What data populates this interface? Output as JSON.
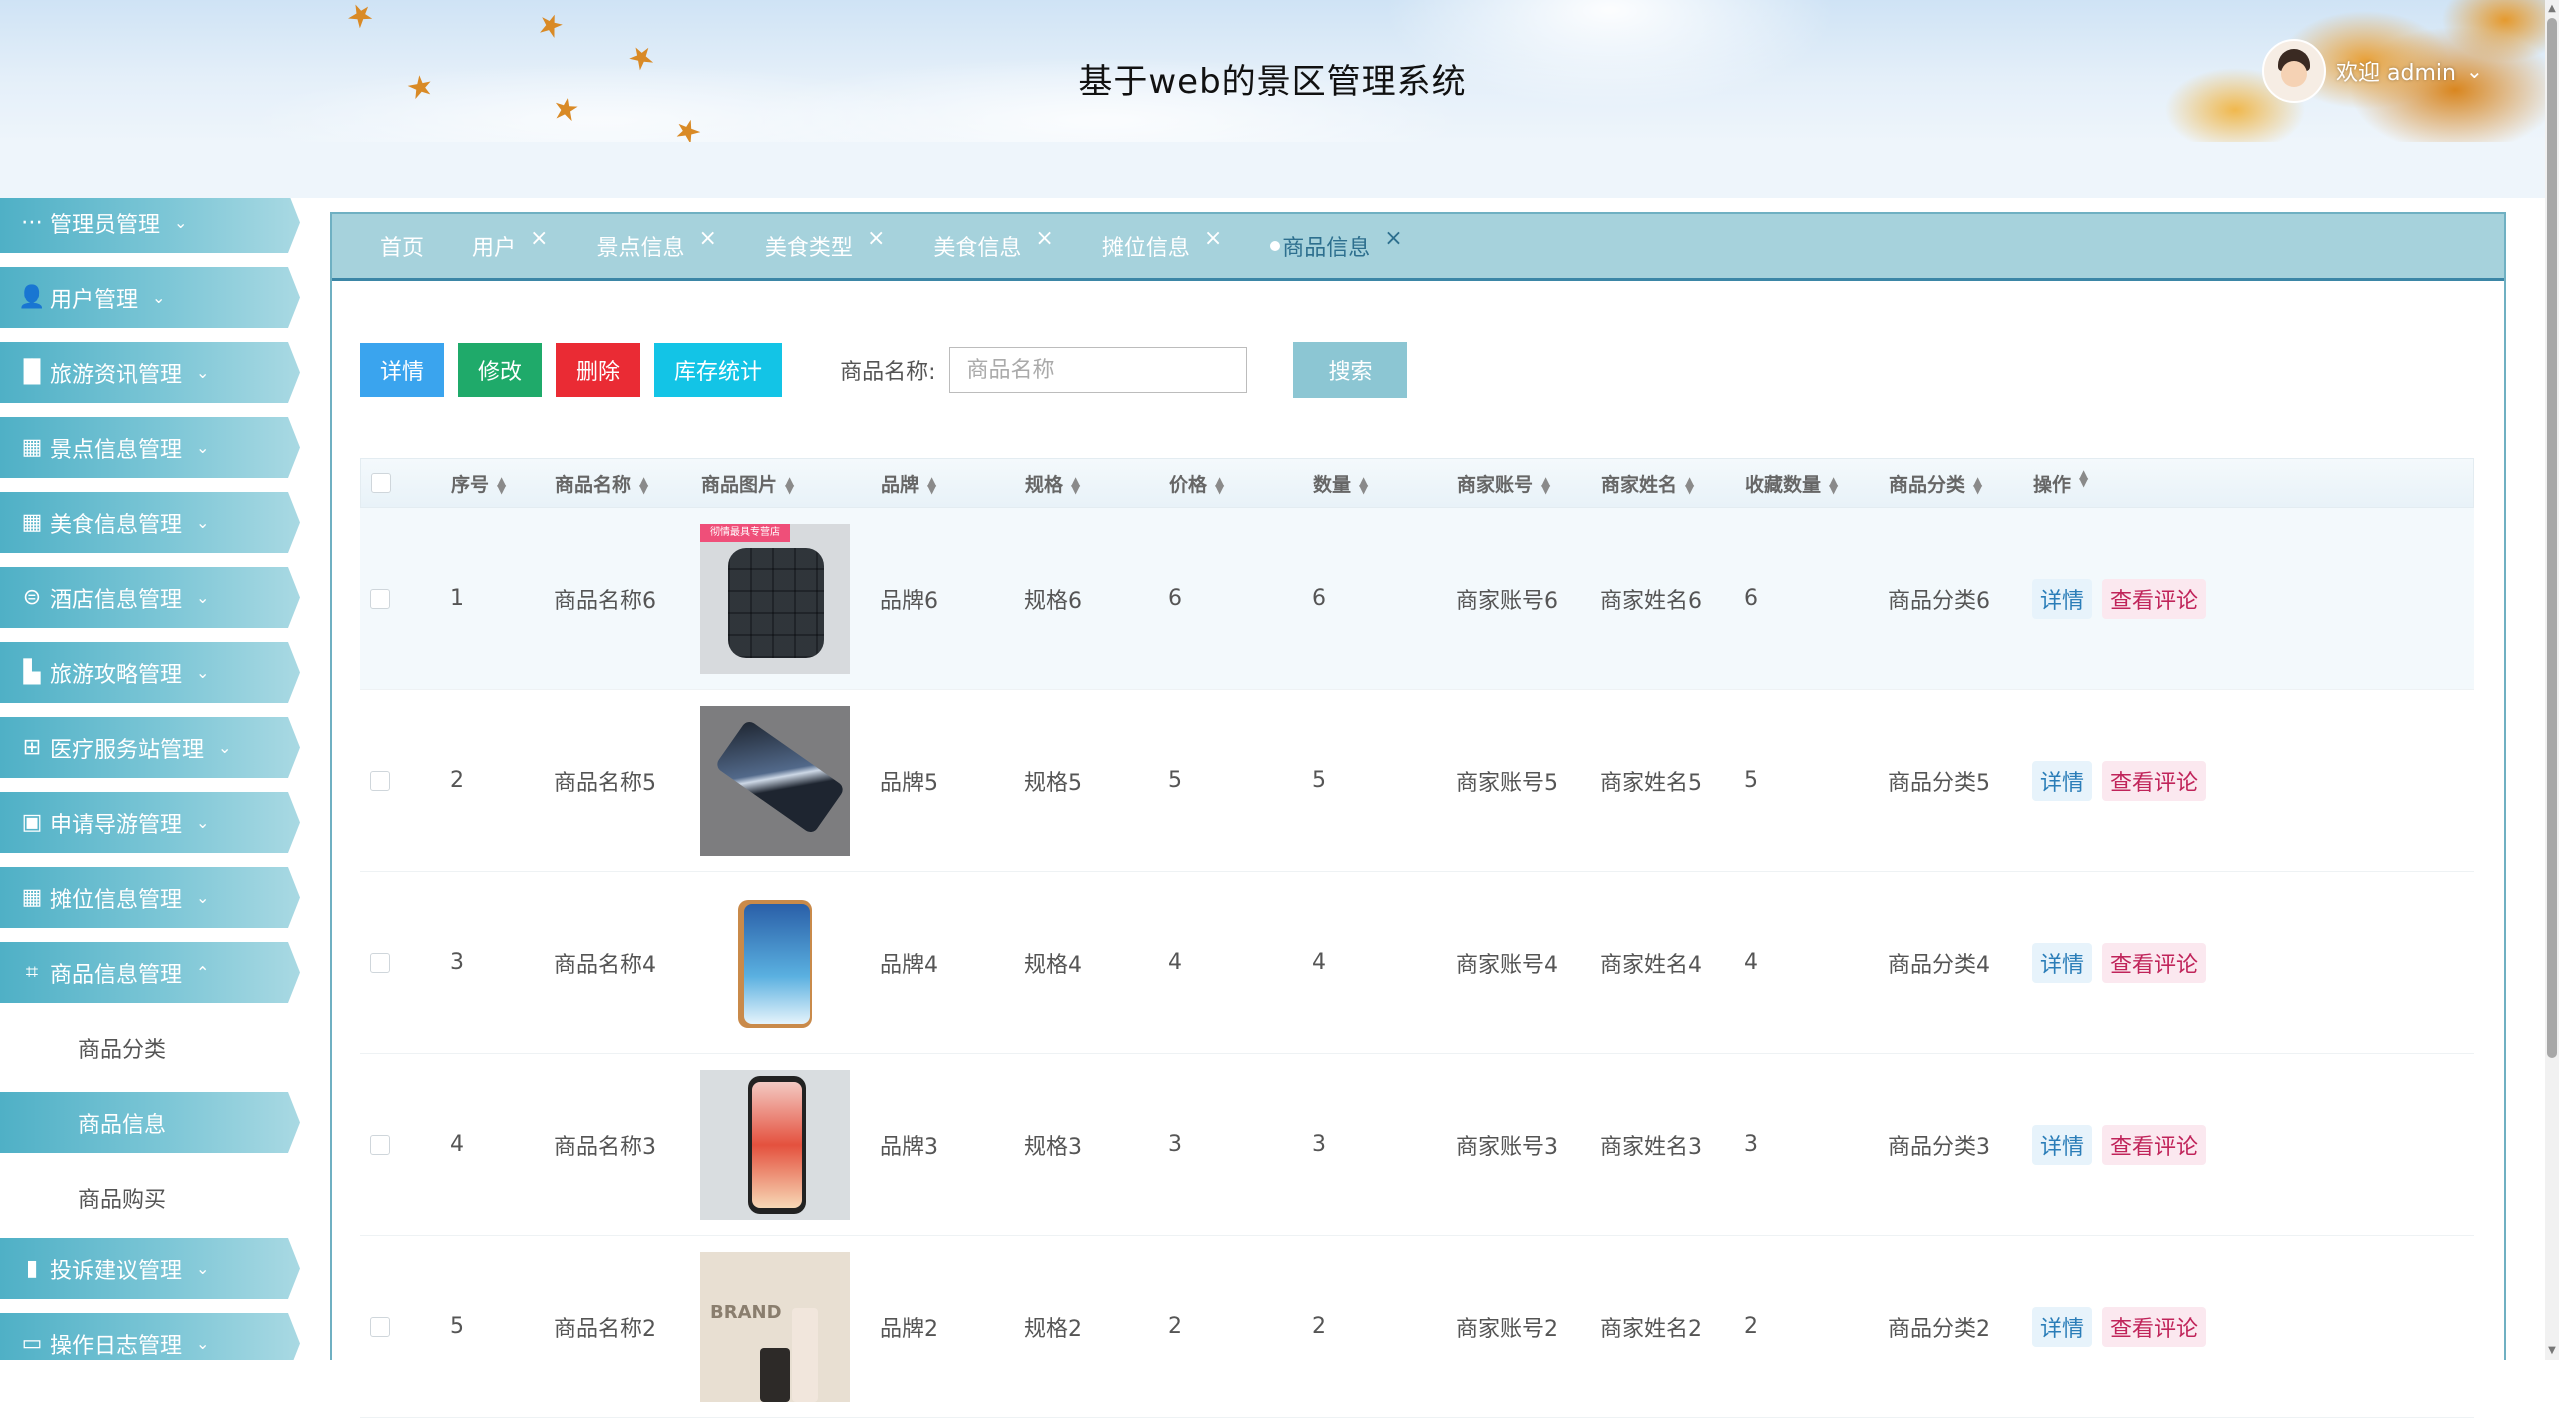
{
  "header": {
    "title": "基于web的景区管理系统",
    "welcome": "欢迎 admin",
    "caret": "⌄"
  },
  "sidebar": {
    "items": [
      {
        "label": "管理员管理",
        "icon": "more-icon",
        "glyph": "⋯",
        "chev": "⌄"
      },
      {
        "label": "用户管理",
        "icon": "user-icon",
        "glyph": "👤",
        "chev": "⌄"
      },
      {
        "label": "旅游资讯管理",
        "icon": "book-icon",
        "glyph": "▐▌",
        "chev": "⌄"
      },
      {
        "label": "景点信息管理",
        "icon": "store-icon",
        "glyph": "▦",
        "chev": "⌄"
      },
      {
        "label": "美食信息管理",
        "icon": "grid-icon",
        "glyph": "▦",
        "chev": "⌄"
      },
      {
        "label": "酒店信息管理",
        "icon": "car-icon",
        "glyph": "⊜",
        "chev": "⌄"
      },
      {
        "label": "旅游攻略管理",
        "icon": "building-icon",
        "glyph": "▙",
        "chev": "⌄"
      },
      {
        "label": "医疗服务站管理",
        "icon": "gift-icon",
        "glyph": "⊞",
        "chev": "⌄"
      },
      {
        "label": "申请导游管理",
        "icon": "briefcase-icon",
        "glyph": "▣",
        "chev": "⌄"
      },
      {
        "label": "摊位信息管理",
        "icon": "apps-icon",
        "glyph": "▦",
        "chev": "⌄"
      },
      {
        "label": "商品信息管理",
        "icon": "crop-icon",
        "glyph": "⌗",
        "chev": "⌃"
      },
      {
        "label": "投诉建议管理",
        "icon": "bookmark-icon",
        "glyph": "▮",
        "chev": "⌄"
      },
      {
        "label": "操作日志管理",
        "icon": "image-icon",
        "glyph": "▭",
        "chev": "⌄"
      }
    ],
    "sub_items": [
      "商品分类",
      "商品信息",
      "商品购买"
    ]
  },
  "tabs": [
    {
      "label": "首页",
      "close": ""
    },
    {
      "label": "用户",
      "close": "×"
    },
    {
      "label": "景点信息",
      "close": "×"
    },
    {
      "label": "美食类型",
      "close": "×"
    },
    {
      "label": "美食信息",
      "close": "×"
    },
    {
      "label": "摊位信息",
      "close": "×"
    },
    {
      "label": "商品信息",
      "close": "×",
      "active": true
    }
  ],
  "toolbar": {
    "detail": "详情",
    "edit": "修改",
    "delete": "删除",
    "stock": "库存统计",
    "search_label": "商品名称:",
    "search_placeholder": "商品名称",
    "search_button": "搜索"
  },
  "table": {
    "columns": [
      "序号",
      "商品名称",
      "商品图片",
      "品牌",
      "规格",
      "价格",
      "数量",
      "商家账号",
      "商家姓名",
      "收藏数量",
      "商品分类",
      "操作"
    ],
    "thumb_tag": "彻情最具专营店",
    "thumb_brand": "BRAND",
    "rows": [
      {
        "idx": "1",
        "name": "商品名称6",
        "brand": "品牌6",
        "spec": "规格6",
        "price": "6",
        "qty": "6",
        "merchant_account": "商家账号6",
        "merchant_name": "商家姓名6",
        "favorites": "6",
        "category": "商品分类6"
      },
      {
        "idx": "2",
        "name": "商品名称5",
        "brand": "品牌5",
        "spec": "规格5",
        "price": "5",
        "qty": "5",
        "merchant_account": "商家账号5",
        "merchant_name": "商家姓名5",
        "favorites": "5",
        "category": "商品分类5"
      },
      {
        "idx": "3",
        "name": "商品名称4",
        "brand": "品牌4",
        "spec": "规格4",
        "price": "4",
        "qty": "4",
        "merchant_account": "商家账号4",
        "merchant_name": "商家姓名4",
        "favorites": "4",
        "category": "商品分类4"
      },
      {
        "idx": "4",
        "name": "商品名称3",
        "brand": "品牌3",
        "spec": "规格3",
        "price": "3",
        "qty": "3",
        "merchant_account": "商家账号3",
        "merchant_name": "商家姓名3",
        "favorites": "3",
        "category": "商品分类3"
      },
      {
        "idx": "5",
        "name": "商品名称2",
        "brand": "品牌2",
        "spec": "规格2",
        "price": "2",
        "qty": "2",
        "merchant_account": "商家账号2",
        "merchant_name": "商家姓名2",
        "favorites": "2",
        "category": "商品分类2"
      }
    ],
    "row_ops": {
      "detail": "详情",
      "review": "查看评论"
    }
  },
  "colors": {
    "accent": "#4fb0c6",
    "tab_bar": "#a6d2dc",
    "btn_detail": "#3aa4ee",
    "btn_edit": "#1faa6a",
    "btn_delete": "#ea2b34",
    "btn_stock": "#13c4e6",
    "btn_search": "#8cc6d3"
  }
}
